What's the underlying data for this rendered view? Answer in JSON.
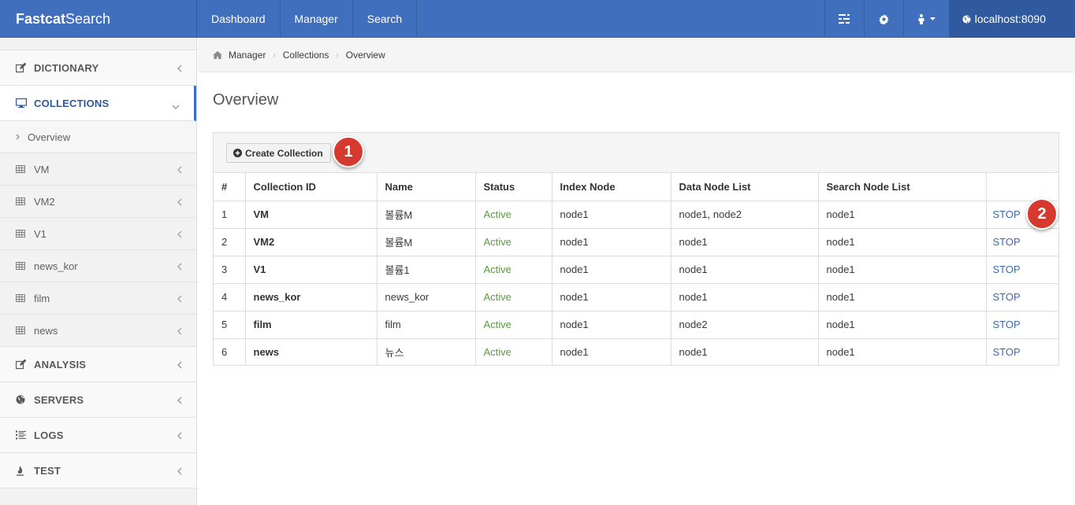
{
  "app": {
    "brand_bold": "Fastcat",
    "brand_light": "Search"
  },
  "nav": {
    "items": [
      "Dashboard",
      "Manager",
      "Search"
    ],
    "host": "localhost:8090"
  },
  "sidebar": {
    "dictionary": "DICTIONARY",
    "collections": "COLLECTIONS",
    "sub_items": [
      "Overview",
      "VM",
      "VM2",
      "V1",
      "news_kor",
      "film",
      "news"
    ],
    "analysis": "ANALYSIS",
    "servers": "SERVERS",
    "logs": "LOGS",
    "test": "TEST"
  },
  "breadcrumb": [
    "Manager",
    "Collections",
    "Overview"
  ],
  "page": {
    "title": "Overview",
    "create_button": "Create Collection"
  },
  "callouts": [
    "1",
    "2"
  ],
  "table": {
    "headers": [
      "#",
      "Collection ID",
      "Name",
      "Status",
      "Index Node",
      "Data Node List",
      "Search Node List",
      ""
    ],
    "rows": [
      [
        "1",
        "VM",
        "볼륨M",
        "Active",
        "node1",
        "node1, node2",
        "node1",
        "STOP"
      ],
      [
        "2",
        "VM2",
        "볼륨M",
        "Active",
        "node1",
        "node1",
        "node1",
        "STOP"
      ],
      [
        "3",
        "V1",
        "볼륨1",
        "Active",
        "node1",
        "node1",
        "node1",
        "STOP"
      ],
      [
        "4",
        "news_kor",
        "news_kor",
        "Active",
        "node1",
        "node1",
        "node1",
        "STOP"
      ],
      [
        "5",
        "film",
        "film",
        "Active",
        "node1",
        "node2",
        "node1",
        "STOP"
      ],
      [
        "6",
        "news",
        "뉴스",
        "Active",
        "node1",
        "node1",
        "node1",
        "STOP"
      ]
    ]
  },
  "colors": {
    "navbar": "#3f6fbd",
    "status_active": "#5a9a3d",
    "link": "#3a6ab0",
    "badge": "#d63a2f"
  }
}
